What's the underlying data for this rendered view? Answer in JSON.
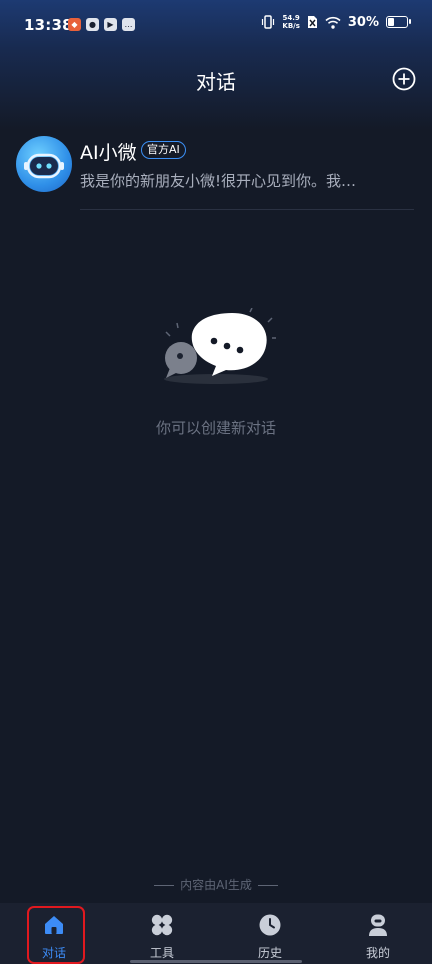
{
  "status_bar": {
    "time": "13:38",
    "net_speed_value": "54.9",
    "net_speed_unit": "KB/s",
    "battery": "30%"
  },
  "header": {
    "title": "对话"
  },
  "conversations": [
    {
      "name": "AI小微",
      "badge": "官方AI",
      "preview": "我是你的新朋友小微!很开心见到你。我…"
    }
  ],
  "empty_state": {
    "text": "你可以创建新对话"
  },
  "footer_note": "内容由AI生成",
  "tabs": [
    {
      "label": "对话",
      "icon": "home-icon",
      "active": true
    },
    {
      "label": "工具",
      "icon": "tools-icon",
      "active": false
    },
    {
      "label": "历史",
      "icon": "clock-icon",
      "active": false
    },
    {
      "label": "我的",
      "icon": "profile-icon",
      "active": false
    }
  ],
  "colors": {
    "background": "#141a27",
    "accent": "#3d8cf6",
    "highlight_box": "#e0191f"
  }
}
